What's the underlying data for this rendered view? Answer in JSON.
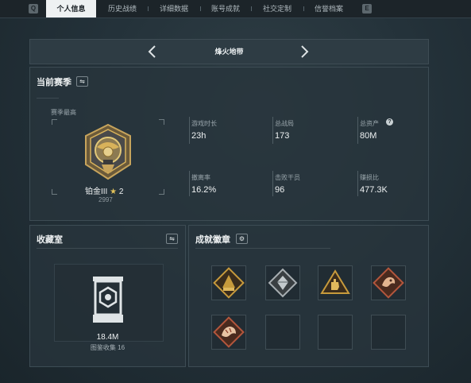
{
  "tabs": [
    {
      "label": "个人信息",
      "active": true
    },
    {
      "label": "历史战绩",
      "active": false
    },
    {
      "label": "详细数据",
      "active": false
    },
    {
      "label": "账号成就",
      "active": false
    },
    {
      "label": "社交定制",
      "active": false
    },
    {
      "label": "信誉档案",
      "active": false
    }
  ],
  "keyhints": {
    "left": "Q",
    "right": "E"
  },
  "season_bar": {
    "title": "烽火地带"
  },
  "current_season": {
    "title": "当前赛季",
    "highest_label": "赛季最高",
    "rank_name": "铂金III",
    "rank_stars": "2",
    "rank_score": "2997",
    "stats": [
      {
        "label": "游戏时长",
        "value": "23h"
      },
      {
        "label": "总战局",
        "value": "173"
      },
      {
        "label": "总资产",
        "value": "80M",
        "has_help": true
      },
      {
        "label": "撤离率",
        "value": "16.2%"
      },
      {
        "label": "击败干员",
        "value": "96"
      },
      {
        "label": "赚损比",
        "value": "477.3K"
      }
    ],
    "help_glyph": "?"
  },
  "collection": {
    "title": "收藏室",
    "value": "18.4M",
    "sub_label": "图鉴收集",
    "sub_value": "16"
  },
  "achievements": {
    "title": "成就徽章",
    "badges": [
      {
        "icon": "pyramid-badge-icon",
        "filled": true,
        "color": "#c79a3c"
      },
      {
        "icon": "crystal-badge-icon",
        "filled": true,
        "color": "#a8aeb2"
      },
      {
        "icon": "hand-badge-icon",
        "filled": true,
        "color": "#c79a3c"
      },
      {
        "icon": "beast-badge-icon",
        "filled": true,
        "color": "#b3563c"
      },
      {
        "icon": "tiger-badge-icon",
        "filled": true,
        "color": "#b3563c"
      },
      {
        "icon": "",
        "filled": false
      },
      {
        "icon": "",
        "filled": false
      },
      {
        "icon": "",
        "filled": false
      }
    ]
  },
  "colors": {
    "accent_gold": "#d8b25a",
    "panel_bg": "#28353c"
  }
}
